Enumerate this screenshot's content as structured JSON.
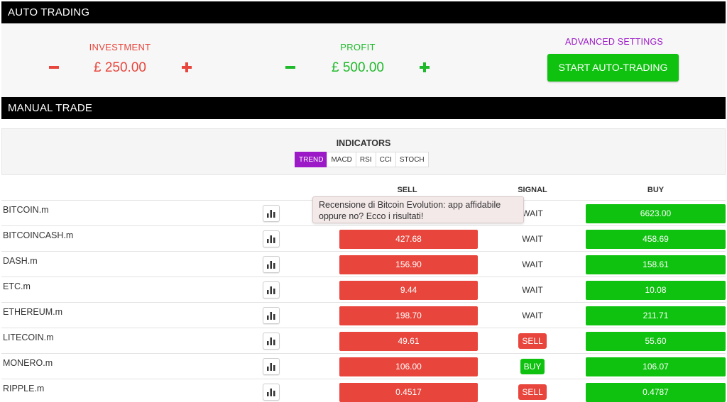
{
  "auto_trading": {
    "header": "AUTO TRADING",
    "investment_label": "INVESTMENT",
    "investment_value": "£ 250.00",
    "profit_label": "PROFIT",
    "profit_value": "£ 500.00",
    "advanced_settings": "ADVANCED SETTINGS",
    "start_button": "START AUTO-TRADING"
  },
  "manual_trade": {
    "header": "MANUAL TRADE",
    "indicators_title": "INDICATORS",
    "indicator_tabs": [
      "TREND",
      "MACD",
      "RSI",
      "CCI",
      "STOCH"
    ],
    "active_tab": "TREND",
    "columns": {
      "sell": "SELL",
      "signal": "SIGNAL",
      "buy": "BUY"
    },
    "rows": [
      {
        "symbol": "BITCOIN.m",
        "sell": "",
        "signal": "WAIT",
        "signal_type": "text",
        "buy": "6623.00"
      },
      {
        "symbol": "BITCOINCASH.m",
        "sell": "427.68",
        "signal": "WAIT",
        "signal_type": "text",
        "buy": "458.69"
      },
      {
        "symbol": "DASH.m",
        "sell": "156.90",
        "signal": "WAIT",
        "signal_type": "text",
        "buy": "158.61"
      },
      {
        "symbol": "ETC.m",
        "sell": "9.44",
        "signal": "WAIT",
        "signal_type": "text",
        "buy": "10.08"
      },
      {
        "symbol": "ETHEREUM.m",
        "sell": "198.70",
        "signal": "WAIT",
        "signal_type": "text",
        "buy": "211.71"
      },
      {
        "symbol": "LITECOIN.m",
        "sell": "49.61",
        "signal": "SELL",
        "signal_type": "sell",
        "buy": "55.60"
      },
      {
        "symbol": "MONERO.m",
        "sell": "106.00",
        "signal": "BUY",
        "signal_type": "buy",
        "buy": "106.07"
      },
      {
        "symbol": "RIPPLE.m",
        "sell": "0.4517",
        "signal": "SELL",
        "signal_type": "sell",
        "buy": "0.4787"
      }
    ],
    "tooltip": "Recensione di Bitcoin Evolution: app affidabile oppure no? Ecco i risultati!"
  },
  "colors": {
    "sell": "#e8453c",
    "buy": "#0fc20f",
    "accent": "#9b19c7",
    "header_bg": "#000000"
  },
  "icons": {
    "minus": "minus-icon",
    "plus": "plus-icon",
    "chart": "bar-chart-icon"
  }
}
